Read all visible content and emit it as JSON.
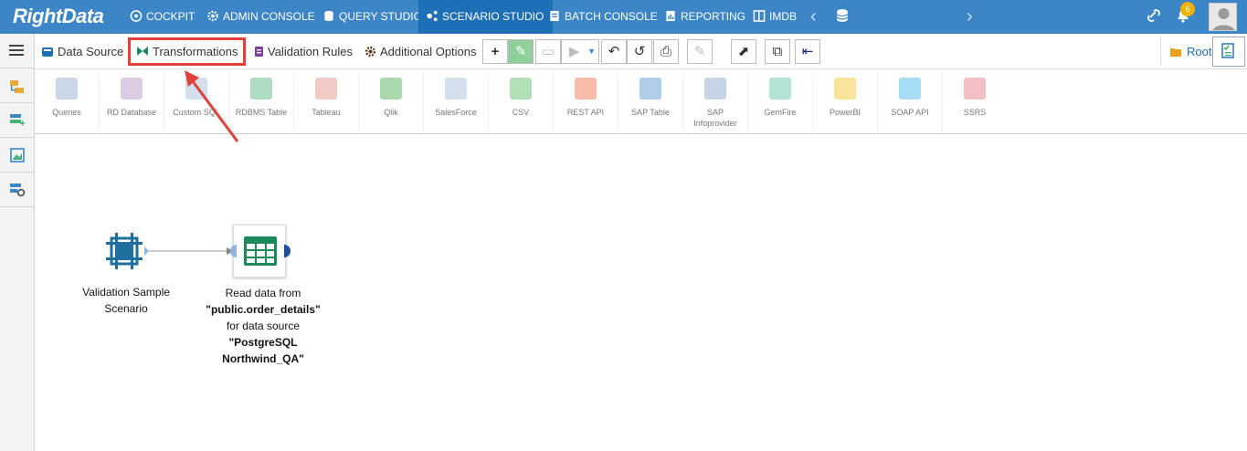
{
  "header": {
    "logo": "RightData",
    "nav": [
      {
        "label": "COCKPIT",
        "icon": "cockpit-icon"
      },
      {
        "label": "ADMIN CONSOLE",
        "icon": "gear-icon"
      },
      {
        "label": "QUERY STUDIO",
        "icon": "database-icon"
      },
      {
        "label": "SCENARIO STUDIO",
        "icon": "scenario-icon",
        "active": true
      },
      {
        "label": "BATCH CONSOLE",
        "icon": "batch-icon"
      },
      {
        "label": "REPORTING",
        "icon": "report-icon"
      },
      {
        "label": "IMDB",
        "icon": "imdb-icon"
      }
    ],
    "notification_count": "6"
  },
  "tabs": {
    "data_source": "Data Source",
    "transformations": "Transformations",
    "validation_rules": "Validation Rules",
    "additional_options": "Additional Options",
    "root": "Root"
  },
  "ribbon": {
    "items": [
      {
        "label": "Queries",
        "color": "#8aa6c8"
      },
      {
        "label": "RD Database",
        "color": "#b08fc4"
      },
      {
        "label": "Custom SQL",
        "color": "#9fb7d6"
      },
      {
        "label": "RDBMS Table",
        "color": "#4bb37d"
      },
      {
        "label": "Tableau",
        "color": "#e38a7f"
      },
      {
        "label": "Qlik",
        "color": "#41a84a"
      },
      {
        "label": "SalesForce",
        "color": "#9fb7d6"
      },
      {
        "label": "CSV",
        "color": "#55b962"
      },
      {
        "label": "REST API",
        "color": "#ef6a3d"
      },
      {
        "label": "SAP Table",
        "color": "#4e8ed0"
      },
      {
        "label": "SAP\nInfoprovider",
        "color": "#7e9ec2"
      },
      {
        "label": "GemFire",
        "color": "#52c0a5"
      },
      {
        "label": "PowerBI",
        "color": "#f2c21b"
      },
      {
        "label": "SOAP API",
        "color": "#39b3e6"
      },
      {
        "label": "SSRS",
        "color": "#e2707a"
      }
    ]
  },
  "canvas": {
    "node1": {
      "label": "Validation Sample Scenario"
    },
    "node2": {
      "line1": "Read data from",
      "line2": "\"public.order_details\"",
      "line3": "for data source",
      "line4": "\"PostgreSQL",
      "line5": "Northwind_QA\""
    }
  },
  "colors": {
    "nav_bg": "#3c86c7",
    "nav_active": "#1e6fb5",
    "highlight": "#e0413a",
    "node_accent": "#1b8a5a"
  }
}
